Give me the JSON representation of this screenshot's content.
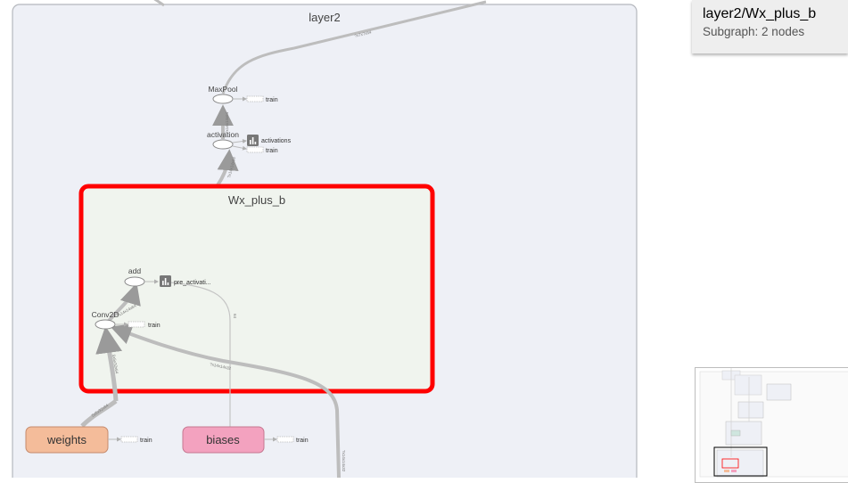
{
  "graph": {
    "outer_group": {
      "label": "layer2"
    },
    "inner_group": {
      "label": "Wx_plus_b",
      "highlight_color": "#ff0000"
    },
    "nodes": {
      "maxpool": {
        "label": "MaxPool",
        "aux": "train"
      },
      "activation": {
        "label": "activation",
        "summary": "activations",
        "aux": "train"
      },
      "add": {
        "label": "add",
        "summary": "pre_activati..."
      },
      "conv2d": {
        "label": "Conv2D",
        "aux": "train"
      },
      "weights": {
        "label": "weights",
        "aux": "train",
        "color": "#f4bc9a"
      },
      "biases": {
        "label": "biases",
        "aux": "train",
        "color": "#f3a2bf"
      }
    },
    "summary_icon": "bar-chart-icon"
  },
  "info_card": {
    "title": "layer2/Wx_plus_b",
    "subtitle": "Subgraph: 2 nodes"
  },
  "minimap": {
    "label": "minimap"
  }
}
